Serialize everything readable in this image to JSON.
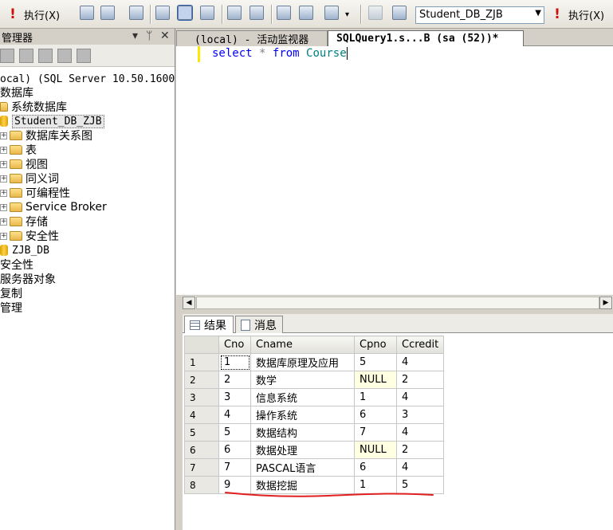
{
  "toolbar": {
    "execute_label": "执行(X)",
    "execute_label_right": "执行(X)",
    "database": "Student_DB_ZJB"
  },
  "explorer": {
    "title": "管理器",
    "title_controls": [
      "▾",
      "ᛘ",
      "✕"
    ],
    "nodes": {
      "server": "ocal) (SQL Server 10.50.1600",
      "databases": "数据库",
      "system_databases": "系统数据库",
      "student_db": "Student_DB_ZJB",
      "diagrams": "数据库关系图",
      "tables": "表",
      "views": "视图",
      "synonyms": "同义词",
      "programmability": "可编程性",
      "service_broker": "Service Broker",
      "storage": "存储",
      "security_db": "安全性",
      "zjb_db": "ZJB_DB",
      "security": "安全性",
      "server_objects": "服务器对象",
      "replication": "复制",
      "management": "管理"
    }
  },
  "tabs": {
    "inactive": "(local) - 活动监视器",
    "active": "SQLQuery1.s...B (sa (52))*"
  },
  "editor": {
    "kw_select": "select",
    "star": "*",
    "kw_from": "from",
    "table": "Course"
  },
  "results": {
    "tab_results": "结果",
    "tab_messages": "消息",
    "columns": [
      "Cno",
      "Cname",
      "Cpno",
      "Ccredit"
    ],
    "rows": [
      [
        "1",
        "1",
        "数据库原理及应用",
        "5",
        "4"
      ],
      [
        "2",
        "2",
        "数学",
        "NULL",
        "2"
      ],
      [
        "3",
        "3",
        "信息系统",
        "1",
        "4"
      ],
      [
        "4",
        "4",
        "操作系统",
        "6",
        "3"
      ],
      [
        "5",
        "5",
        "数据结构",
        "7",
        "4"
      ],
      [
        "6",
        "6",
        "数据处理",
        "NULL",
        "2"
      ],
      [
        "7",
        "7",
        "PASCAL语言",
        "6",
        "4"
      ],
      [
        "8",
        "9",
        "数据挖掘",
        "1",
        "5"
      ]
    ]
  },
  "colors": {
    "keyword": "#0000ff",
    "object": "#008080",
    "null_cell": "#ffffe1",
    "annotation": "#e02020"
  }
}
